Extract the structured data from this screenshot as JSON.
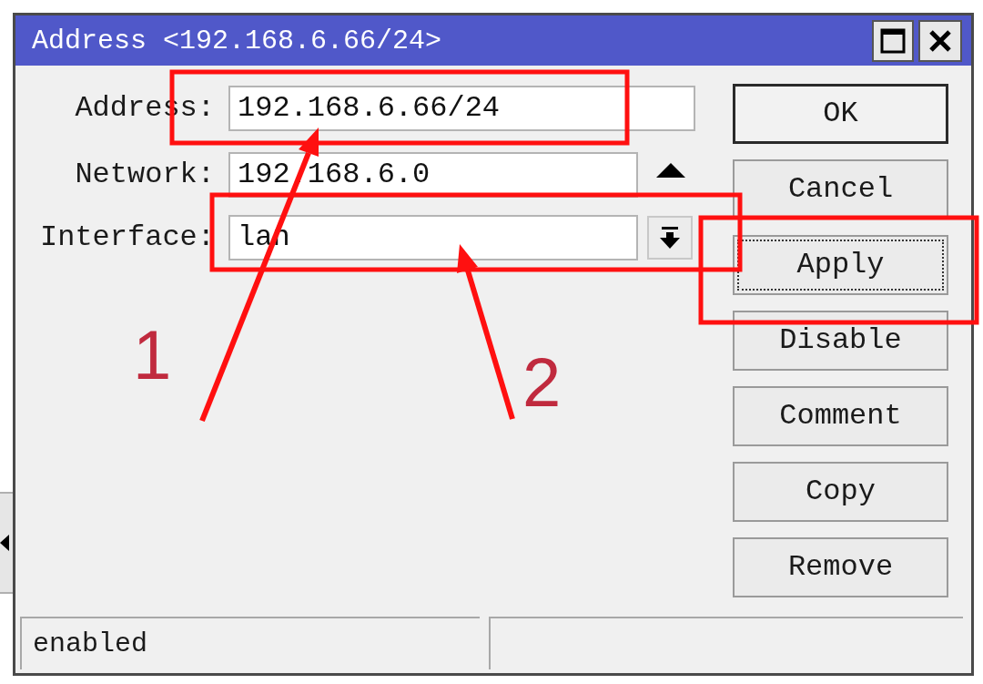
{
  "window": {
    "title": "Address <192.168.6.66/24>"
  },
  "fields": [
    {
      "label": "Address:",
      "value": "192.168.6.66/24",
      "kind": "text"
    },
    {
      "label": "Network:",
      "value": "192.168.6.0",
      "kind": "spin"
    },
    {
      "label": "Interface:",
      "value": "lan",
      "kind": "dropdown"
    }
  ],
  "buttons": [
    {
      "label": "OK",
      "kind": "default"
    },
    {
      "label": "Cancel",
      "kind": "normal"
    },
    {
      "label": "Apply",
      "kind": "focused"
    },
    {
      "label": "Disable",
      "kind": "normal"
    },
    {
      "label": "Comment",
      "kind": "normal"
    },
    {
      "label": "Copy",
      "kind": "normal"
    },
    {
      "label": "Remove",
      "kind": "normal"
    }
  ],
  "status_bar": {
    "status": "enabled"
  },
  "annotations": [
    {
      "label": "1"
    },
    {
      "label": "2"
    }
  ]
}
